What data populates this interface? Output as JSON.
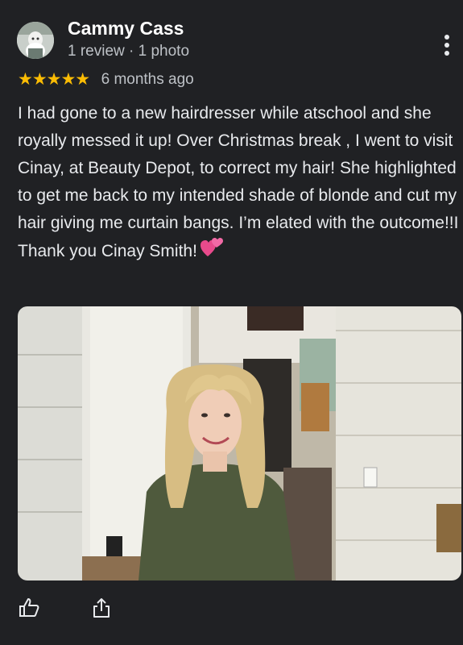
{
  "review": {
    "author_name": "Cammy Cass",
    "author_meta": "1 review · 1 photo",
    "rating": 5,
    "stars": "★★★★★",
    "date": "6 months ago",
    "text": "I had gone to a new hairdresser while atschool and she royally messed it up! Over Christmas break , I went to visit Cinay, at Beauty Depot, to correct my hair! She highlighted to get me back to my intended shade of blonde and cut my hair giving me curtain bangs. I’m elated with the outcome!!I Thank you Cinay Smith!",
    "emoji": "two-hearts-emoji"
  },
  "icons": {
    "more": "more-vert-icon",
    "like": "thumbs-up-icon",
    "share": "share-icon"
  },
  "colors": {
    "background": "#202124",
    "star": "#fbbc04",
    "text": "#e8eaed",
    "secondary_text": "#bdc1c6"
  }
}
